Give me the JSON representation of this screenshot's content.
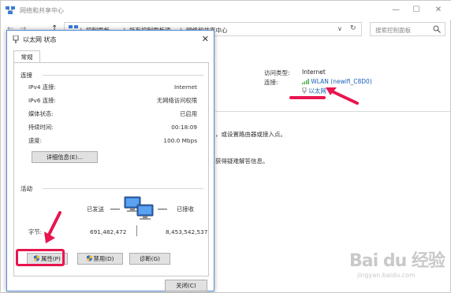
{
  "background_window": {
    "title": "网络和共享中心",
    "controls": {
      "minimize": "—",
      "maximize": "☐",
      "close": "✕"
    },
    "nav": {
      "back": "←",
      "forward": "→",
      "up": "↑"
    },
    "breadcrumbs": [
      "控制面板",
      "所有控制面板项",
      "网络和共享中心"
    ],
    "search_placeholder": "搜索控制面板",
    "access_type_label": "访问类型:",
    "access_type_value": "Internet",
    "connections_label": "连接:",
    "connection_wlan": "WLAN (newifi_C8D0)",
    "connection_ethernet": "以太网",
    "partial_line_1": "，或设置路由器或接入点。",
    "partial_line_2": "获得疑难解答信息。"
  },
  "dialog": {
    "title": "以太网 状态",
    "close_glyph": "✕",
    "tab": "常规",
    "connection_section": "连接",
    "properties": [
      {
        "key": "IPv4 连接:",
        "value": "Internet"
      },
      {
        "key": "IPv6 连接:",
        "value": "无网络访问权限"
      },
      {
        "key": "媒体状态:",
        "value": "已启用"
      },
      {
        "key": "持续时间:",
        "value": "00:18:09"
      },
      {
        "key": "速度:",
        "value": "100.0 Mbps"
      }
    ],
    "details_button": "详细信息(E)...",
    "activity_section": "活动",
    "sent_label": "已发送",
    "received_label": "已接收",
    "bytes_label": "字节:",
    "bytes_sent": "691,482,472",
    "bytes_received": "8,453,542,537",
    "properties_button": "属性(P)",
    "disable_button": "禁用(D)",
    "diagnose_button": "诊断(G)",
    "close_button": "关闭(C)"
  },
  "watermark": {
    "main": "Bai du 经验",
    "sub": "jingyan.baidu.com"
  },
  "colors": {
    "annotation_red": "#e8154e",
    "link_blue": "#1c5fb8",
    "dialog_border": "#5a8fd6"
  }
}
